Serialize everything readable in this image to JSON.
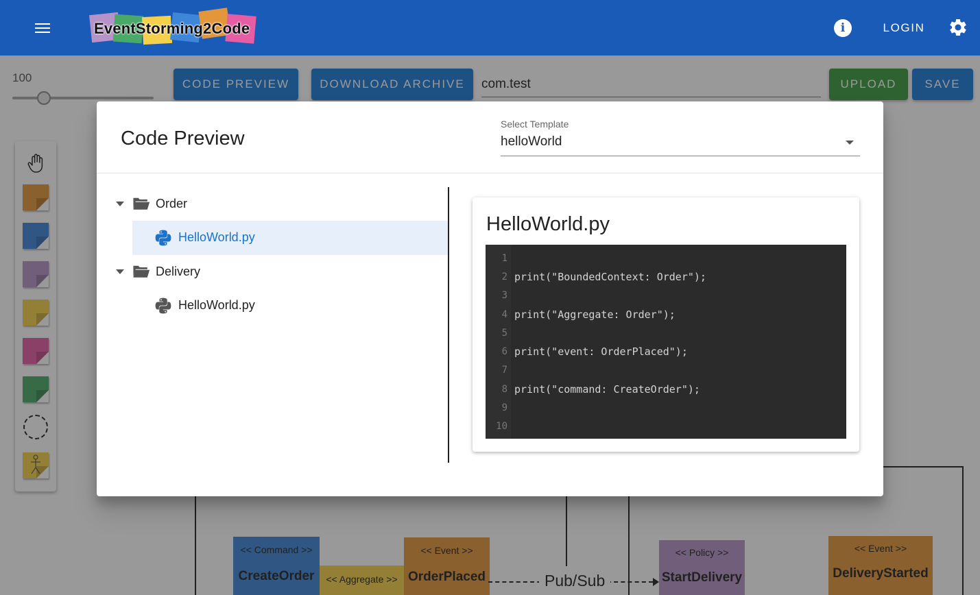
{
  "app": {
    "logo_text": "EventStorming2Code",
    "login_label": "LOGIN"
  },
  "toolbar": {
    "zoom_value": "100",
    "code_preview_label": "CODE PREVIEW",
    "download_archive_label": "DOWNLOAD ARCHIVE",
    "package_value": "com.test",
    "upload_label": "UPLOAD",
    "save_label": "SAVE"
  },
  "colors": {
    "appbar": "#1b5bb8",
    "primary_button": "#1d7ad6",
    "upload_button": "#3b9a3f",
    "event": "#e3963a",
    "command": "#3e86d9",
    "aggregate": "#f5d04a",
    "policy": "#b592c8",
    "external": "#e65da3",
    "read_model": "#4aa868",
    "selection": "#e7f0fa",
    "code_bg": "#2b2b2b"
  },
  "palette": {
    "items": [
      "hand-tool",
      "event-sticker",
      "command-sticker",
      "policy-sticker",
      "aggregate-sticker",
      "external-system-sticker",
      "read-model-sticker",
      "bounded-context",
      "actor-sticker"
    ]
  },
  "canvas": {
    "stickers": [
      {
        "type": "<< Command >>",
        "name": "CreateOrder"
      },
      {
        "type": "<< Aggregate >>",
        "name": ""
      },
      {
        "type": "<< Event >>",
        "name": "OrderPlaced"
      },
      {
        "type": "<< Policy >>",
        "name": "StartDelivery"
      },
      {
        "type": "<< Event >>",
        "name": "DeliveryStarted"
      }
    ],
    "relation_label": "Pub/Sub"
  },
  "dialog": {
    "title": "Code Preview",
    "template_label": "Select Template",
    "template_value": "helloWorld",
    "tree": [
      {
        "folder": "Order",
        "files": [
          "HelloWorld.py"
        ]
      },
      {
        "folder": "Delivery",
        "files": [
          "HelloWorld.py"
        ]
      }
    ],
    "preview": {
      "file_name": "HelloWorld.py",
      "line_numbers": [
        "1",
        "2",
        "3",
        "4",
        "5",
        "6",
        "7",
        "8",
        "9",
        "10"
      ],
      "lines": [
        "",
        "print(\"BoundedContext: Order\");",
        "",
        "print(\"Aggregate: Order\");",
        "",
        "print(\"event: OrderPlaced\");",
        "",
        "print(\"command: CreateOrder\");",
        "",
        ""
      ]
    }
  }
}
